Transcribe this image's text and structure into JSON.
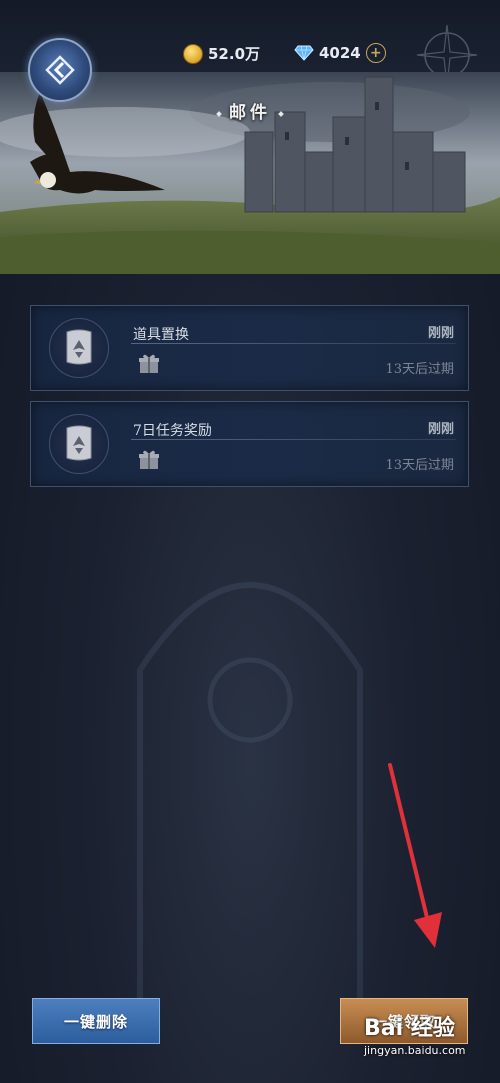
{
  "currency": {
    "gold_value": "52.0万",
    "diamond_value": "4024"
  },
  "banner": {
    "title": "邮件"
  },
  "mails": [
    {
      "title": "道具置换",
      "time": "刚刚",
      "expire": "13天后过期"
    },
    {
      "title": "7日任务奖励",
      "time": "刚刚",
      "expire": "13天后过期"
    }
  ],
  "actions": {
    "delete_all_label": "一键删除",
    "claim_all_label": "一键领取"
  },
  "watermark": {
    "logo": "Bai 经验",
    "url": "jingyan.baidu.com"
  },
  "colors": {
    "accent_blue": "#3a6ead",
    "accent_bronze": "#a8713c",
    "annotation_arrow": "#e0303a"
  }
}
